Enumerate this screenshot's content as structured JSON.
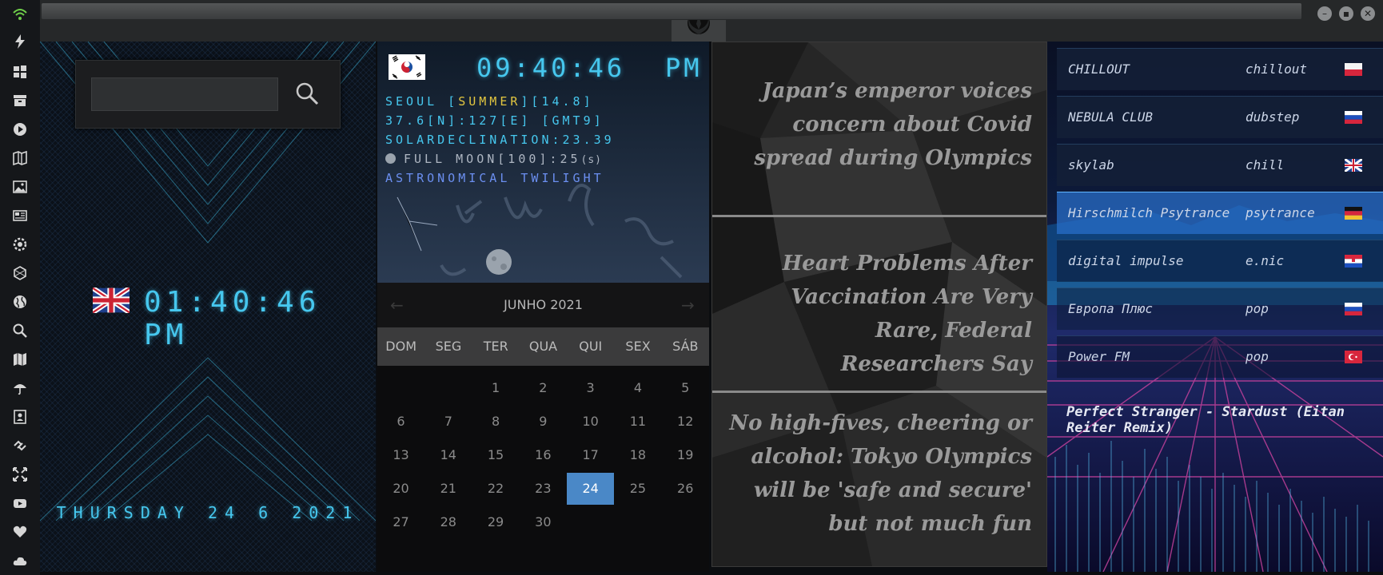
{
  "theme": {
    "accent": "#46c7ee",
    "calendar_highlight": "#4a88c7"
  },
  "sidebar": {
    "icons": [
      "wifi-icon",
      "lightning-icon",
      "windows-icon",
      "archive-icon",
      "play-icon",
      "map-book-icon",
      "image-icon",
      "news-icon",
      "settings-icon",
      "hexagon-icon",
      "globe-icon",
      "search-icon",
      "map-icon",
      "umbrella-icon",
      "contacts-icon",
      "link-icon",
      "fullscreen-icon",
      "youtube-icon",
      "heart-icon",
      "cloud-icon"
    ]
  },
  "window": {
    "logo": "rebel-alliance-logo"
  },
  "clock_uk": {
    "time": "01:40:46 PM",
    "date": "THURSDAY 24 6 2021"
  },
  "search": {
    "placeholder": ""
  },
  "clock_kr": {
    "time": "09:40:46",
    "ampm": "PM",
    "line1_a": "SEOUL [",
    "line1_season": "SUMMER",
    "line1_b": "][14.8]",
    "line2": "37.6[N]:127[E] [GMT9]",
    "line3": "SOLARDECLINATION:23.39",
    "line4": "FULL MOON[100]:25",
    "line4_suffix": "(s)",
    "line5": "ASTRONOMICAL TWILIGHT"
  },
  "calendar": {
    "month_label": "JUNHO 2021",
    "prev": "←",
    "next": "→",
    "weekdays": [
      "DOM",
      "SEG",
      "TER",
      "QUA",
      "QUI",
      "SEX",
      "SÁB"
    ],
    "first_weekday_index": 2,
    "days_in_month": 30,
    "today": 24
  },
  "news": [
    {
      "headline": "Japan’s emperor voices concern about Covid spread during Olympics"
    },
    {
      "headline": "Heart Problems After Vaccination Are Very Rare, Federal Researchers Say"
    },
    {
      "headline": "No high-fives, cheering or alcohol: Tokyo Olympics will be 'safe and secure' but not much fun"
    }
  ],
  "radio": {
    "stations": [
      {
        "name": "CHILLOUT",
        "genre": "chillout",
        "flag": "poland"
      },
      {
        "name": "NEBULA CLUB",
        "genre": "dubstep",
        "flag": "russia"
      },
      {
        "name": "skylab",
        "genre": "chill",
        "flag": "uk"
      },
      {
        "name": "Hirschmilch Psytrance",
        "genre": "psytrance",
        "flag": "germany"
      },
      {
        "name": "digital impulse",
        "genre": "e.nic",
        "flag": "croatia"
      },
      {
        "name": "Европа Плюс",
        "genre": "pop",
        "flag": "russia"
      },
      {
        "name": "Power FM",
        "genre": "pop",
        "flag": "turkey"
      }
    ],
    "now_playing": "Perfect Stranger - Stardust (Eitan Reiter Remix)"
  }
}
